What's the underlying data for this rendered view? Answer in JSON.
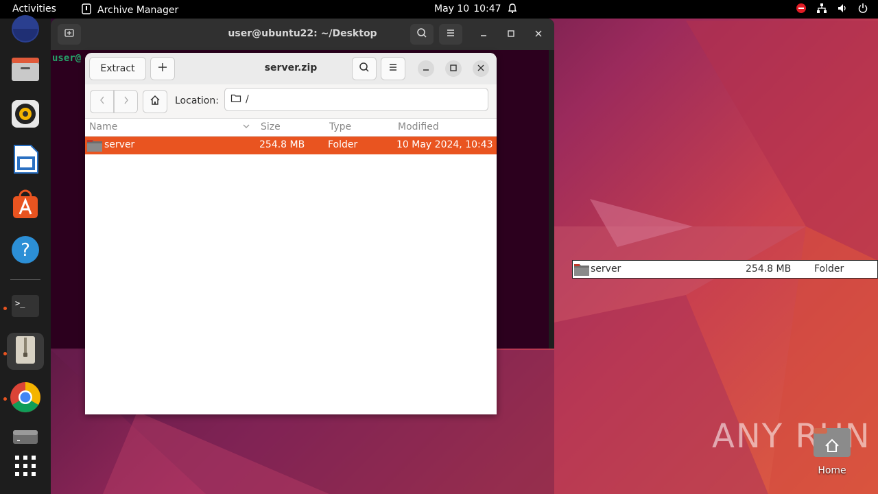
{
  "topbar": {
    "activities": "Activities",
    "app_name": "Archive Manager",
    "date": "May 10",
    "time": "10:47"
  },
  "dock": {
    "items": [
      "Firefox",
      "Files",
      "Rhythmbox",
      "LibreOffice Writer",
      "Ubuntu Software",
      "Help",
      "Terminal",
      "Archive Manager",
      "Google Chrome",
      "Removable Drive",
      "Show Applications"
    ]
  },
  "terminal": {
    "title": "user@ubuntu22: ~/Desktop",
    "prompt": "user@"
  },
  "archive": {
    "title": "server.zip",
    "extract_label": "Extract",
    "add_label": "+",
    "location_label": "Location:",
    "location_value": "/",
    "columns": {
      "name": "Name",
      "size": "Size",
      "type": "Type",
      "modified": "Modified"
    },
    "rows": [
      {
        "name": "server",
        "size": "254.8 MB",
        "type": "Folder",
        "modified": "10 May 2024, 10:43"
      }
    ]
  },
  "drag_item": {
    "name": "server",
    "size": "254.8 MB",
    "type": "Folder"
  },
  "desktop": {
    "home_label": "Home",
    "watermark": "ANY RUN"
  },
  "colors": {
    "accent": "#e95420",
    "topbar": "#000000",
    "dock": "#1d1d1d",
    "terminal_bg": "#2c001e"
  }
}
